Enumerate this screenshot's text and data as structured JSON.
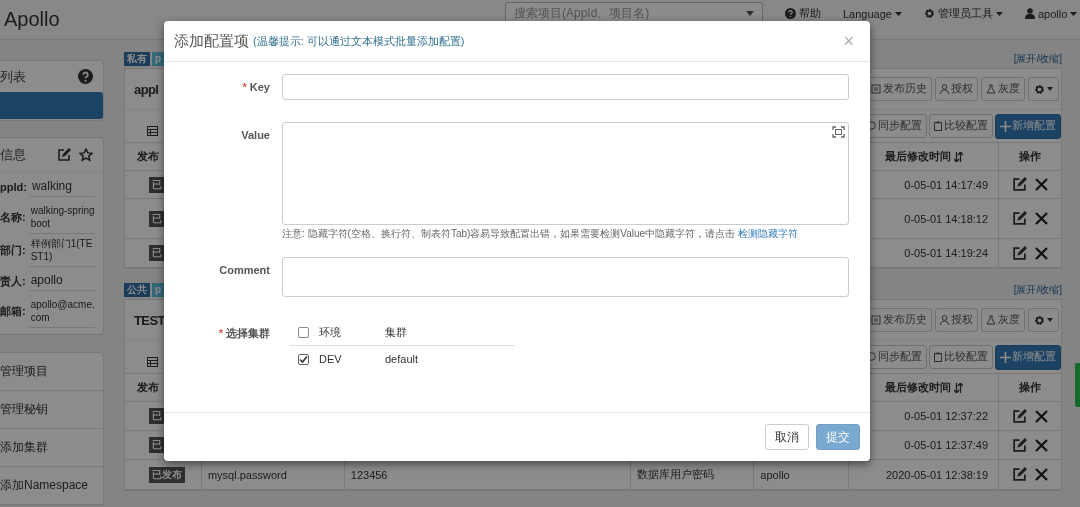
{
  "navbar": {
    "brand": "Apollo",
    "search": {
      "placeholder": "搜索项目(AppId、项目名)"
    },
    "items": [
      {
        "kind": "help",
        "label": "帮助"
      },
      {
        "kind": "language",
        "label": "Language"
      },
      {
        "kind": "admin",
        "label": "管理员工具"
      },
      {
        "kind": "user",
        "label": "apollo"
      }
    ]
  },
  "sidebar": {
    "env_panel": {
      "title": "列表"
    },
    "app_panel": {
      "title": "信息",
      "fields": [
        {
          "label": "ppId:",
          "value": "walking",
          "small": false
        },
        {
          "label": "名称:",
          "value": "walking-spring boot",
          "small": true
        },
        {
          "label": "部门:",
          "value": "样例部门1(TEST1)",
          "small": true
        },
        {
          "label": "责人:",
          "value": "apollo",
          "small": false
        },
        {
          "label": "邮箱:",
          "value": "apollo@acme.com",
          "small": true
        }
      ]
    },
    "menu": [
      {
        "label": "管理项目"
      },
      {
        "label": "管理秘钥"
      },
      {
        "label": "添加集群"
      },
      {
        "label": "添加Namespace"
      }
    ]
  },
  "namespaces": [
    {
      "tags": [
        {
          "kind": "private",
          "text": "私有"
        },
        {
          "kind": "format",
          "text": "p"
        }
      ],
      "toggle": "[展开/收缩]",
      "title": "appl",
      "actions": [
        "发布历史",
        "授权",
        "灰度"
      ],
      "buttons": [
        {
          "kind": "sync",
          "label": "同步配置"
        },
        {
          "kind": "compare",
          "label": "比较配置"
        },
        {
          "kind": "add",
          "label": "新增配置"
        }
      ],
      "columns": {
        "status": "发布",
        "modified_time": "最后修改时间",
        "actions": "操作"
      },
      "rows": [
        {
          "status": "已",
          "time": "0-05-01 14:17:49"
        },
        {
          "status": "已",
          "time": "0-05-01 14:18:12"
        },
        {
          "status": "已",
          "time": "0-05-01 14:19:24"
        }
      ]
    },
    {
      "tags": [
        {
          "kind": "public",
          "text": "公共"
        },
        {
          "kind": "format",
          "text": "p"
        }
      ],
      "toggle": "[展开/收缩]",
      "title": "TEST",
      "actions": [
        "发布历史",
        "授权",
        "灰度"
      ],
      "buttons": [
        {
          "kind": "sync",
          "label": "同步配置"
        },
        {
          "kind": "compare",
          "label": "比较配置"
        },
        {
          "kind": "add",
          "label": "新增配置"
        }
      ],
      "columns": {
        "status": "发布",
        "modified_time": "最后修改时间",
        "actions": "操作"
      },
      "rows": [
        {
          "status": "已",
          "time": "0-05-01 12:37:22"
        },
        {
          "status": "已",
          "time": "0-05-01 12:37:49"
        },
        {
          "status": "已发布",
          "key": "mysql.password",
          "value": "123456",
          "comment": "数据库用户密码",
          "modifier": "apollo",
          "time": "2020-05-01 12:38:19"
        }
      ]
    }
  ],
  "modal": {
    "title": "添加配置项",
    "hint": "(温馨提示: 可以通过文本模式批量添加配置)",
    "close": "×",
    "key_field": {
      "marker": "*",
      "label": "Key"
    },
    "value_field": {
      "label": "Value"
    },
    "note": {
      "text": "注意: 隐藏字符(空格、换行符、制表符Tab)容易导致配置出错，如果需要检测Value中隐藏字符，请点击",
      "link": "检测隐藏字符"
    },
    "comment_field": {
      "label": "Comment"
    },
    "cluster": {
      "marker": "*",
      "label": "选择集群",
      "header_checked": false,
      "columns": [
        "环境",
        "集群"
      ],
      "rows": [
        {
          "checked": true,
          "env": "DEV",
          "cluster": "default"
        }
      ]
    },
    "buttons": [
      {
        "kind": "default",
        "label": "取消",
        "disabled": false
      },
      {
        "kind": "primary",
        "label": "提交",
        "disabled": true
      }
    ]
  }
}
